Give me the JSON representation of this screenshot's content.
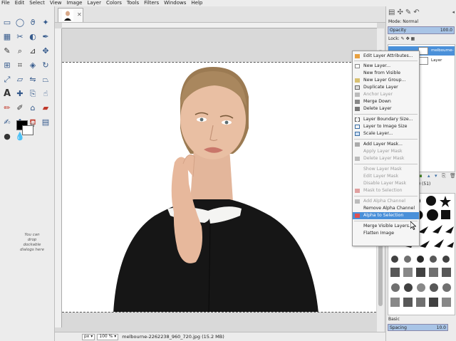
{
  "menubar": [
    "File",
    "Edit",
    "Select",
    "View",
    "Image",
    "Layer",
    "Colors",
    "Tools",
    "Filters",
    "Windows",
    "Help"
  ],
  "toolbox": {
    "tools": [
      "rect-select",
      "ellipse-select",
      "free-select",
      "fuzzy-select",
      "select-by-color",
      "scissors",
      "foreground-select",
      "paths",
      "color-picker",
      "zoom",
      "measure",
      "move",
      "align",
      "crop",
      "unified-transform",
      "rotate",
      "scale",
      "shear",
      "flip",
      "perspective",
      "text",
      "heal",
      "clone",
      "smudge",
      "paintbrush",
      "pencil",
      "airbrush",
      "eraser",
      "ink",
      "mypaint",
      "bucket-fill",
      "blend",
      "dodge",
      "blur"
    ],
    "drop_hint": "You can drop dockable dialogs here"
  },
  "canvas": {
    "image_file": "melbourne-2262238_960_720.jpg"
  },
  "statusbar": {
    "unit": "px",
    "zoom": "100 %",
    "file_info": "melbourne-2262238_960_720.jpg (15.2 MB)"
  },
  "dock": {
    "mode_label": "Mode: Normal",
    "opacity_label": "Opacity",
    "opacity_value": "100.0",
    "lock_label": "Lock:",
    "layers": [
      {
        "name": "melbourne-2262",
        "selected": true
      },
      {
        "name": "Layer",
        "selected": false
      }
    ],
    "brush_name": "(Hardness 075) (51)",
    "basic_label": "Basic",
    "spacing_label": "Spacing",
    "spacing_value": "10.0"
  },
  "context_menu": {
    "items": [
      {
        "label": "Edit Layer Attributes...",
        "enabled": true
      },
      {
        "label": "New Layer...",
        "enabled": true
      },
      {
        "label": "New from Visible",
        "enabled": true
      },
      {
        "label": "New Layer Group...",
        "enabled": true
      },
      {
        "label": "Duplicate Layer",
        "enabled": true
      },
      {
        "label": "Anchor Layer",
        "enabled": false
      },
      {
        "label": "Merge Down",
        "enabled": true
      },
      {
        "label": "Delete Layer",
        "enabled": true
      },
      {
        "label": "Layer Boundary Size...",
        "enabled": true
      },
      {
        "label": "Layer to Image Size",
        "enabled": true
      },
      {
        "label": "Scale Layer...",
        "enabled": true
      },
      {
        "label": "Add Layer Mask...",
        "enabled": true
      },
      {
        "label": "Apply Layer Mask",
        "enabled": false
      },
      {
        "label": "Delete Layer Mask",
        "enabled": false
      },
      {
        "label": "Show Layer Mask",
        "enabled": false
      },
      {
        "label": "Edit Layer Mask",
        "enabled": false
      },
      {
        "label": "Disable Layer Mask",
        "enabled": false
      },
      {
        "label": "Mask to Selection",
        "enabled": false
      },
      {
        "label": "Add Alpha Channel",
        "enabled": false
      },
      {
        "label": "Remove Alpha Channel",
        "enabled": true
      },
      {
        "label": "Alpha to Selection",
        "enabled": true,
        "highlighted": true
      },
      {
        "label": "Merge Visible Layers...",
        "enabled": true
      },
      {
        "label": "Flatten Image",
        "enabled": true
      }
    ]
  },
  "colors": {
    "highlight": "#4a90d9",
    "foreground": "#000000",
    "background": "#ffffff"
  }
}
